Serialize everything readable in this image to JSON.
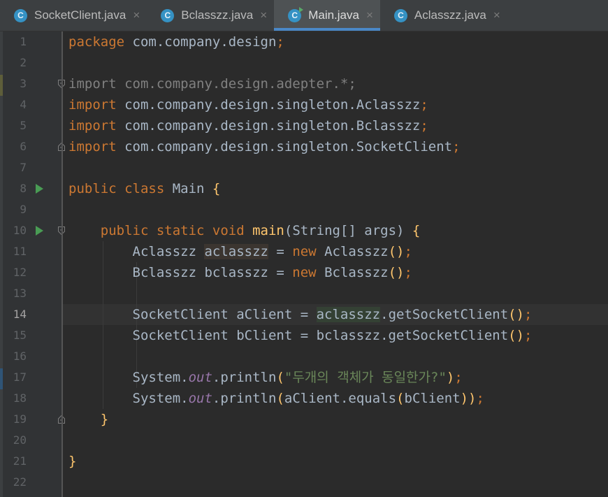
{
  "tabs": [
    {
      "label": "SocketClient.java",
      "icon": "C",
      "active": false
    },
    {
      "label": "Bclasszz.java",
      "icon": "C",
      "active": false
    },
    {
      "label": "Main.java",
      "icon": "C",
      "active": true
    },
    {
      "label": "Aclasszz.java",
      "icon": "C",
      "active": false
    }
  ],
  "tab_close_glyph": "×",
  "current_line": 14,
  "lines": [
    {
      "n": "1",
      "tokens": [
        [
          "kw",
          "package "
        ],
        [
          "",
          "com.company.design"
        ],
        [
          "kw",
          ";"
        ]
      ]
    },
    {
      "n": "2",
      "tokens": []
    },
    {
      "n": "3",
      "tokens": [
        [
          "unused",
          "import com.company.design.adepter.*;"
        ]
      ]
    },
    {
      "n": "4",
      "tokens": [
        [
          "kw",
          "import "
        ],
        [
          "",
          "com.company.design.singleton.Aclasszz"
        ],
        [
          "kw",
          ";"
        ]
      ]
    },
    {
      "n": "5",
      "tokens": [
        [
          "kw",
          "import "
        ],
        [
          "",
          "com.company.design.singleton.Bclasszz"
        ],
        [
          "kw",
          ";"
        ]
      ]
    },
    {
      "n": "6",
      "tokens": [
        [
          "kw",
          "import "
        ],
        [
          "",
          "com.company.design.singleton.SocketClient"
        ],
        [
          "kw",
          ";"
        ]
      ]
    },
    {
      "n": "7",
      "tokens": []
    },
    {
      "n": "8",
      "tokens": [
        [
          "kw",
          "public class "
        ],
        [
          "",
          "Main "
        ],
        [
          "fn",
          "{"
        ]
      ]
    },
    {
      "n": "9",
      "tokens": []
    },
    {
      "n": "10",
      "tokens": [
        [
          "",
          "    "
        ],
        [
          "kw",
          "public static void "
        ],
        [
          "fn",
          "main"
        ],
        [
          "",
          "(String[] args) "
        ],
        [
          "fn",
          "{"
        ]
      ]
    },
    {
      "n": "11",
      "tokens": [
        [
          "",
          "        Aclasszz "
        ],
        [
          "hl-var",
          "aclasszz"
        ],
        [
          "",
          " = "
        ],
        [
          "kw",
          "new "
        ],
        [
          "",
          "Aclasszz"
        ],
        [
          "fn",
          "()"
        ],
        [
          "kw",
          ";"
        ]
      ]
    },
    {
      "n": "12",
      "tokens": [
        [
          "",
          "        Bclasszz bclasszz = "
        ],
        [
          "kw",
          "new "
        ],
        [
          "",
          "Bclasszz"
        ],
        [
          "fn",
          "()"
        ],
        [
          "kw",
          ";"
        ]
      ]
    },
    {
      "n": "13",
      "tokens": []
    },
    {
      "n": "14",
      "tokens": [
        [
          "",
          "        SocketClient aClient = "
        ],
        [
          "hl-green",
          "aclasszz"
        ],
        [
          "",
          ".getSocketClient"
        ],
        [
          "fn",
          "()"
        ],
        [
          "kw",
          ";"
        ]
      ]
    },
    {
      "n": "15",
      "tokens": [
        [
          "",
          "        SocketClient bClient = bclasszz.getSocketClient"
        ],
        [
          "fn",
          "()"
        ],
        [
          "kw",
          ";"
        ]
      ]
    },
    {
      "n": "16",
      "tokens": []
    },
    {
      "n": "17",
      "tokens": [
        [
          "",
          "        System."
        ],
        [
          "fld",
          "out"
        ],
        [
          "",
          ".println"
        ],
        [
          "fn",
          "("
        ],
        [
          "str",
          "\"두개의 객체가 동일한가?\""
        ],
        [
          "fn",
          ")"
        ],
        [
          "kw",
          ";"
        ]
      ]
    },
    {
      "n": "18",
      "tokens": [
        [
          "",
          "        System."
        ],
        [
          "fld",
          "out"
        ],
        [
          "",
          ".println"
        ],
        [
          "fn",
          "("
        ],
        [
          "",
          "aClient.equals"
        ],
        [
          "fn",
          "("
        ],
        [
          "",
          "bClient"
        ],
        [
          "fn",
          "))"
        ],
        [
          "kw",
          ";"
        ]
      ]
    },
    {
      "n": "19",
      "tokens": [
        [
          "",
          "    "
        ],
        [
          "fn",
          "}"
        ]
      ]
    },
    {
      "n": "20",
      "tokens": []
    },
    {
      "n": "21",
      "tokens": [
        [
          "fn",
          "}"
        ]
      ]
    },
    {
      "n": "22",
      "tokens": []
    }
  ],
  "run_markers": [
    "8",
    "10"
  ],
  "fold_markers": [
    {
      "line": "3",
      "kind": "start"
    },
    {
      "line": "6",
      "kind": "end"
    },
    {
      "line": "10",
      "kind": "start"
    },
    {
      "line": "19",
      "kind": "end"
    }
  ],
  "colors": {
    "background": "#2b2b2b",
    "keyword": "#cc7832",
    "function": "#ffc66d",
    "string": "#6a8759",
    "field": "#9876aa",
    "text": "#a9b7c6",
    "tab_accent": "#4a88c7"
  }
}
